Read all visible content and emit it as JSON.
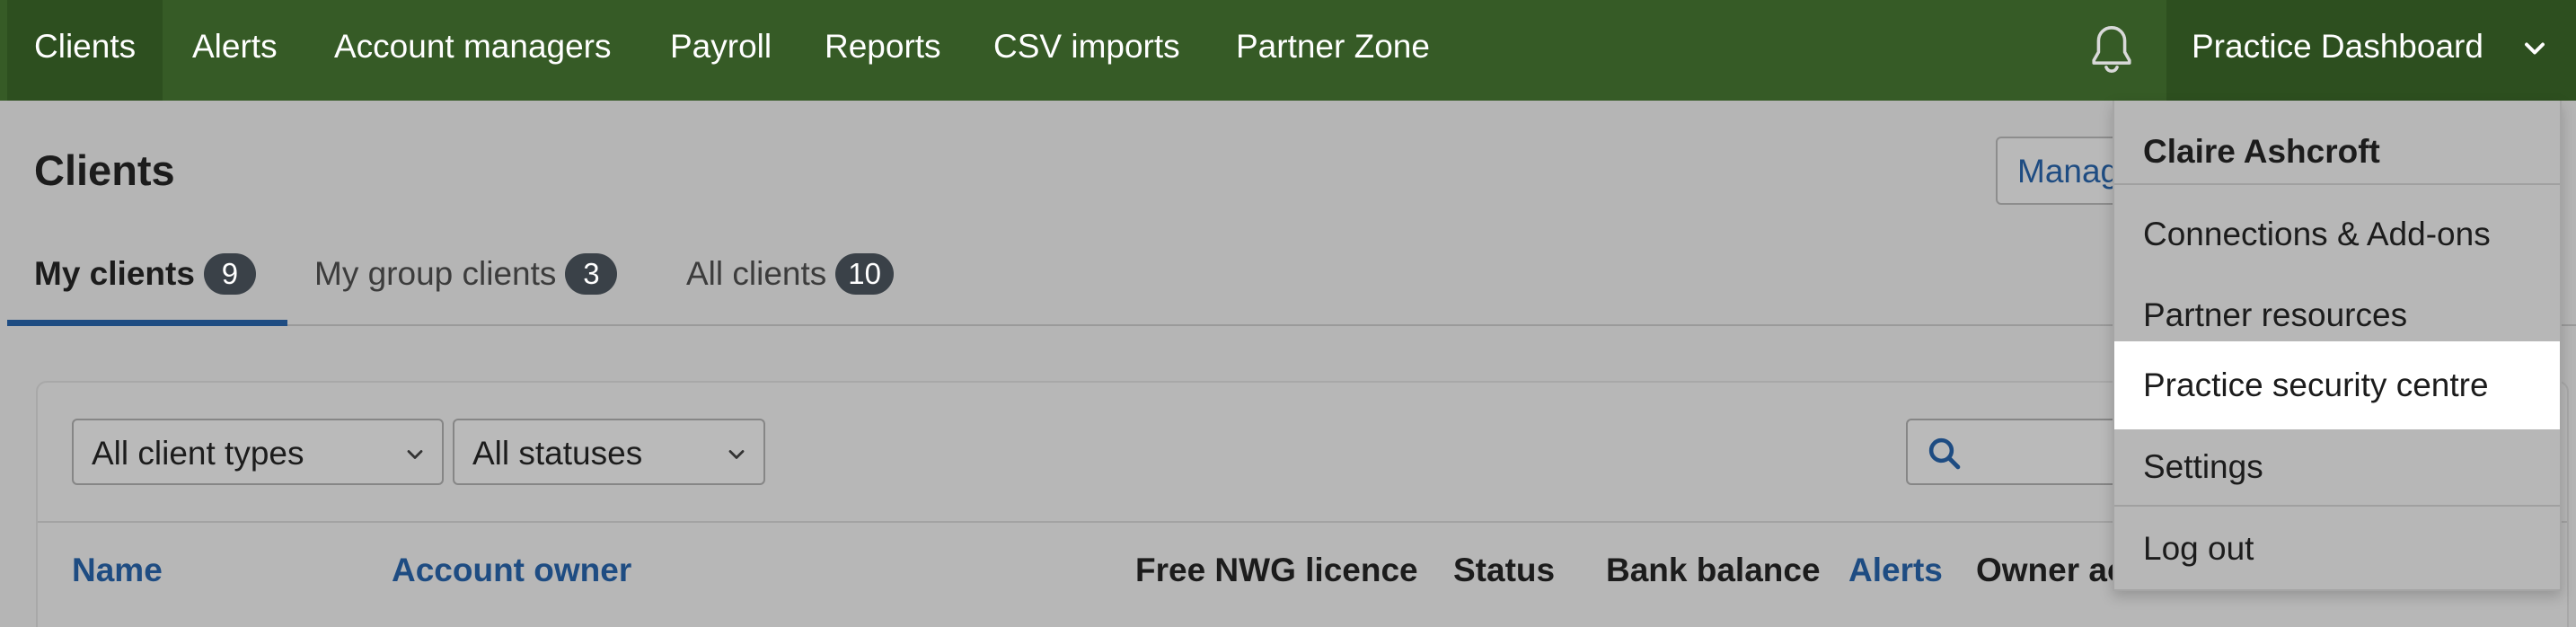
{
  "nav": {
    "items": [
      {
        "label": "Clients"
      },
      {
        "label": "Alerts"
      },
      {
        "label": "Account managers"
      },
      {
        "label": "Payroll"
      },
      {
        "label": "Reports"
      },
      {
        "label": "CSV imports"
      },
      {
        "label": "Partner Zone"
      }
    ],
    "dashboard_label": "Practice Dashboard",
    "notification_icon": "bell-icon",
    "dropdown_icon": "chevron-down-icon"
  },
  "page": {
    "title": "Clients",
    "manage_button_label": "Manag"
  },
  "tabs": [
    {
      "label": "My clients",
      "count": "9"
    },
    {
      "label": "My group clients",
      "count": "3"
    },
    {
      "label": "All clients",
      "count": "10"
    }
  ],
  "filters": {
    "client_type": "All client types",
    "status": "All statuses",
    "search_icon": "search-icon"
  },
  "table": {
    "columns": [
      "Name",
      "Account owner",
      "Free NWG licence",
      "Status",
      "Bank balance",
      "Alerts",
      "Owner ac"
    ]
  },
  "dropdown": {
    "user_name": "Claire Ashcroft",
    "items": [
      {
        "label": "Connections & Add-ons"
      },
      {
        "label": "Partner resources"
      },
      {
        "label": "Practice security centre"
      },
      {
        "label": "Settings"
      },
      {
        "label": "Log out"
      }
    ]
  },
  "colors": {
    "nav_bg": "#365b26",
    "nav_active_bg": "#2d4f1f",
    "link_blue": "#1e4c82",
    "badge_bg": "#3a4148"
  }
}
